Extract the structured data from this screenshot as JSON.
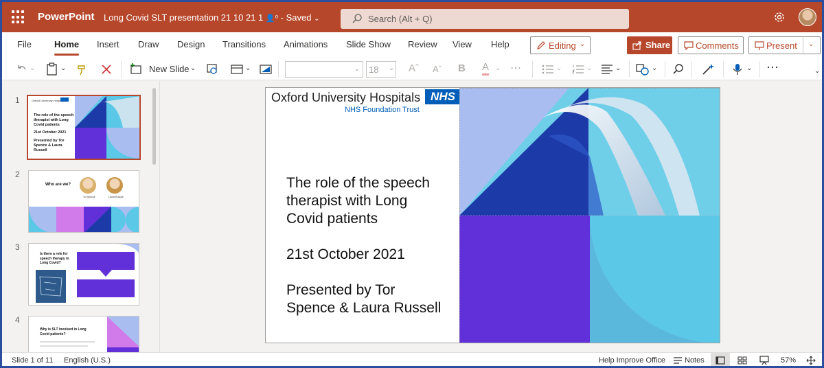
{
  "app": {
    "name": "PowerPoint",
    "doc_title": "Long Covid SLT presentation 21 10 21 1",
    "save_state": "Saved"
  },
  "search": {
    "placeholder": "Search (Alt + Q)"
  },
  "menu": {
    "tabs": [
      "File",
      "Home",
      "Insert",
      "Draw",
      "Design",
      "Transitions",
      "Animations",
      "Slide Show",
      "Review",
      "View",
      "Help"
    ],
    "active": "Home",
    "editing_label": "Editing",
    "share_label": "Share",
    "comments_label": "Comments",
    "present_label": "Present"
  },
  "toolbar": {
    "new_slide_label": "New Slide",
    "font_size": "18"
  },
  "thumbnails": [
    {
      "num": "1",
      "title": "The role of the speech therapist with Long Covid patients",
      "date": "21st October 2021",
      "by": "Presented by Tor Spence & Laura Russell"
    },
    {
      "num": "2",
      "title": "Who are we?",
      "name1": "Tor Spence",
      "name2": "Laura Russell"
    },
    {
      "num": "3",
      "title": "Is there a role for speech therapy in Long Covid?"
    },
    {
      "num": "4",
      "title": "Why is SLT involved in Long Covid patients?"
    }
  ],
  "slide": {
    "org": "Oxford University Hospitals",
    "nhs": "NHS",
    "trust": "NHS Foundation Trust",
    "title_lines": [
      "The role of the speech",
      "therapist with Long",
      "Covid patients"
    ],
    "date": "21st October 2021",
    "presenter_lines": [
      "Presented by Tor",
      "Spence & Laura Russell"
    ]
  },
  "status": {
    "slide_counter": "Slide 1 of 11",
    "language": "English (U.S.)",
    "help_improve": "Help Improve Office",
    "notes_label": "Notes",
    "zoom": "57%"
  },
  "colors": {
    "brand": "#b7472a",
    "nhs_blue": "#005eb8",
    "slide_purple": "#6230d8",
    "slide_navy": "#1c3aa8",
    "slide_cyan": "#5ac8e6",
    "slide_periwinkle": "#a9bdf1"
  }
}
